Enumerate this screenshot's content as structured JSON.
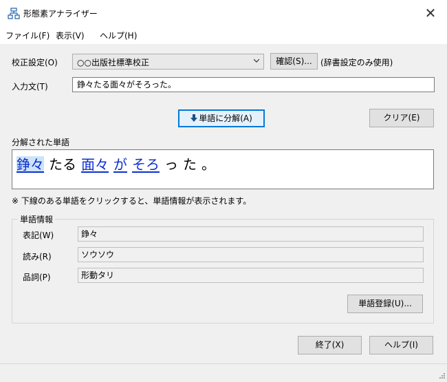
{
  "window": {
    "title": "形態素アナライザー",
    "close_glyph": "✕"
  },
  "menu": [
    {
      "label": "ファイル(F)"
    },
    {
      "label": "表示(V)"
    },
    {
      "label": "ヘルプ(H)"
    }
  ],
  "proofing": {
    "label": "校正設定(O)",
    "selected": "○○出版社標準校正",
    "confirm_button": "確認(S)...",
    "note": "(辞書設定のみ使用)"
  },
  "input": {
    "label": "入力文(T)",
    "value": "錚々たる面々がそろった。"
  },
  "actions": {
    "split_button": "単語に分解(A)",
    "clear_button": "クリア(E)"
  },
  "result": {
    "label": "分解された単語",
    "words": [
      {
        "text": "錚々",
        "link": true,
        "selected": true
      },
      {
        "text": "たる",
        "link": false,
        "selected": false
      },
      {
        "text": "面々",
        "link": true,
        "selected": false
      },
      {
        "text": "が",
        "link": true,
        "selected": false
      },
      {
        "text": "そろ",
        "link": true,
        "selected": false
      },
      {
        "text": "っ",
        "link": false,
        "selected": false
      },
      {
        "text": "た",
        "link": false,
        "selected": false
      },
      {
        "text": "。",
        "link": false,
        "selected": false
      }
    ],
    "hint": "※ 下線のある単語をクリックすると、単語情報が表示されます。"
  },
  "word_info": {
    "title": "単語情報",
    "notation_label": "表記(W)",
    "notation_value": "錚々",
    "reading_label": "読み(R)",
    "reading_value": "ソウソウ",
    "pos_label": "品詞(P)",
    "pos_value": "形動タリ",
    "register_button": "単語登録(U)..."
  },
  "footer": {
    "exit_button": "終了(X)",
    "help_button": "ヘルプ(I)"
  },
  "colors": {
    "link": "#0b2dcf",
    "accent": "#0078d7"
  }
}
